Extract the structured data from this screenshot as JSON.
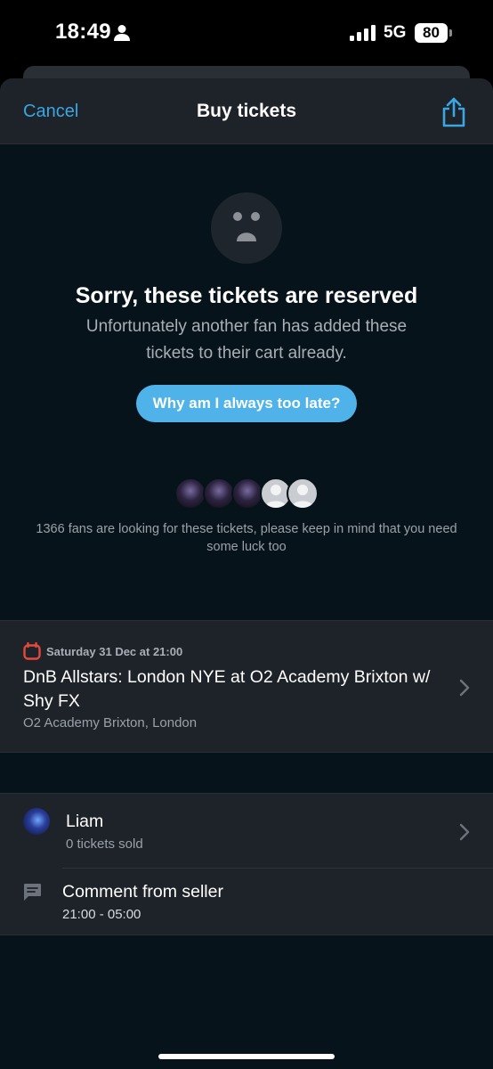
{
  "status_bar": {
    "time": "18:49",
    "network": "5G",
    "battery": "80",
    "icons": [
      "person-icon",
      "signal-icon",
      "battery-icon"
    ]
  },
  "nav": {
    "cancel_label": "Cancel",
    "title": "Buy tickets",
    "share_icon": "share-icon"
  },
  "reserved": {
    "icon": "sad-face-icon",
    "title": "Sorry, these tickets are reserved",
    "body": "Unfortunately another fan has added these tickets to their cart already.",
    "button_label": "Why am I always too late?",
    "fans_text": "1366 fans are looking for these tickets, please keep in mind that you need some luck too"
  },
  "event": {
    "icon": "calendar-icon",
    "date": "Saturday 31 Dec at 21:00",
    "title": "DnB Allstars: London NYE at O2 Academy Brixton w/ Shy FX",
    "venue": "O2 Academy Brixton, London"
  },
  "seller": {
    "name": "Liam",
    "sold": "0 tickets sold",
    "comment_icon": "comment-icon",
    "comment_title": "Comment from seller",
    "comment_body": "21:00 - 05:00"
  },
  "colors": {
    "accent": "#3aa6e2",
    "button": "#4fb3ea",
    "calendar": "#e5493c",
    "sheet_bg": "#07131a",
    "card_bg": "#1e2229"
  }
}
